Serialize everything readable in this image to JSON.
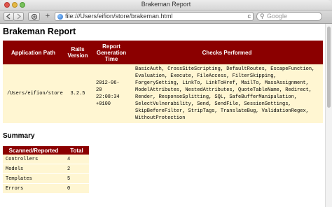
{
  "window": {
    "title": "Brakeman Report"
  },
  "toolbar": {
    "back_icon": "back-arrow-icon",
    "forward_icon": "forward-arrow-icon",
    "url": "file:///Users/eifion/store/brakeman.html",
    "search_placeholder": "Google",
    "new_tab": "+",
    "reload": "c"
  },
  "page": {
    "title": "Brakeman Report",
    "scan_table": {
      "headers": [
        "Application Path",
        "Rails Version",
        "Report Generation Time",
        "Checks Performed"
      ],
      "row": {
        "path": "/Users/eifion/store",
        "rails_version": "3.2.5",
        "time_lines": [
          "2012-06-",
          "20",
          "22:08:34",
          "+0100"
        ],
        "checks": "BasicAuth, CrossSiteScripting, DefaultRoutes, EscapeFunction, Evaluation, Execute, FileAccess, FilterSkipping, ForgerySetting, LinkTo, LinkToHref, MailTo, MassAssignment, ModelAttributes, NestedAttributes, QuoteTableName, Redirect, Render, ResponseSplitting, SQL, SafeBufferManipulation, SelectVulnerability, Send, SendFile, SessionSettings, SkipBeforeFilter, StripTags, TranslateBug, ValidationRegex, WithoutProtection"
      }
    },
    "summary": {
      "title": "Summary",
      "headers": [
        "Scanned/Reported",
        "Total"
      ],
      "rows": [
        {
          "label": "Controllers",
          "total": "4"
        },
        {
          "label": "Models",
          "total": "2"
        },
        {
          "label": "Templates",
          "total": "5"
        },
        {
          "label": "Errors",
          "total": "0"
        }
      ]
    }
  }
}
